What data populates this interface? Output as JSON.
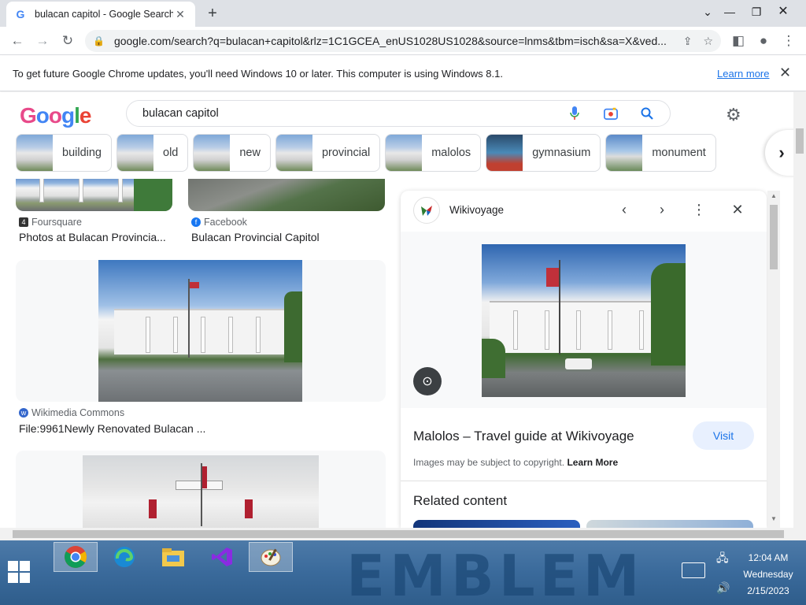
{
  "browser": {
    "tab_title": "bulacan capitol - Google Search",
    "tab_favicon": "G",
    "url": "google.com/search?q=bulacan+capitol&rlz=1C1GCEA_enUS1028US1028&source=lnms&tbm=isch&sa=X&ved..."
  },
  "infobar": {
    "message": "To get future Google Chrome updates, you'll need Windows 10 or later. This computer is using Windows 8.1.",
    "link": "Learn more"
  },
  "search": {
    "logo": "Google",
    "query": "bulacan capitol"
  },
  "chips": [
    {
      "label": "building"
    },
    {
      "label": "old"
    },
    {
      "label": "new"
    },
    {
      "label": "provincial"
    },
    {
      "label": "malolos"
    },
    {
      "label": "gymnasium"
    },
    {
      "label": "monument"
    }
  ],
  "results": [
    {
      "source": "Foursquare",
      "title": "Photos at Bulacan Provincia..."
    },
    {
      "source": "Facebook",
      "title": "Bulacan Provincial Capitol"
    },
    {
      "source": "Wikimedia Commons",
      "title": "File:9961Newly Renovated Bulacan ..."
    }
  ],
  "panel": {
    "site": "Wikivoyage",
    "title": "Malolos – Travel guide at Wikivoyage",
    "visit_label": "Visit",
    "copyright": "Images may be subject to copyright.",
    "learn_more": "Learn More",
    "related": "Related content"
  },
  "taskbar": {
    "wallpaper_text": "EMBLEM",
    "time": "12:04 AM",
    "day": "Wednesday",
    "date": "2/15/2023"
  },
  "colors": {
    "link": "#1a73e8",
    "chrome_frame": "#dee1e6"
  }
}
